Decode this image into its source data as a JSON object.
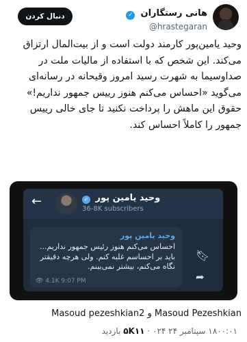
{
  "profile": {
    "display_name": "هانی رستگاران",
    "handle": "@hrastegaran",
    "follow_label": "دنبال کردن"
  },
  "tweet": {
    "paragraph1": "وحید یامین‌پور کارمند دولت است و از بیت‌المال ارتزاق می‌کند. این شخص که با استفاده از مالیات ملت در صداوسیما به شهرت رسید امروز وقیحانه در رسانه‌ای می‌گوید «احساس می‌کنم هنوز رییس جمهور نداریم!»",
    "paragraph2": "حقوق این ماهش را پرداخت نکنید تا جای خالی رییس جمهور را کاملاً احساس کند."
  },
  "telegram_screenshot": {
    "channel_name": "وحید یامین پور",
    "subscribers": "36-8K subscribers",
    "message_author": "وحید یامین پور",
    "message_text": "احساس می‌کنم هنوز رئیس جمهور نداریم... باید بر احساسم غلبه کنم. ولی هرچه دقیقتر نگاه می‌کنم، بیشتر نمی‌بینم.",
    "views_time": "👁 4.1K  9:07 PM",
    "colors": {
      "header": "#243447",
      "bubble": "#263646",
      "accent": "#5ea7e8"
    }
  },
  "mentions": {
    "text1": "Masoud Pezeshkian",
    "connector": " و ",
    "text2": "Masoud pezeshkian2"
  },
  "footer": {
    "time_date": "۱۸۰۰:۰۱ سپتامبر ۲۴ ۰۲۴",
    "views": "۵K۱۱",
    "views_label": "بازدید"
  }
}
